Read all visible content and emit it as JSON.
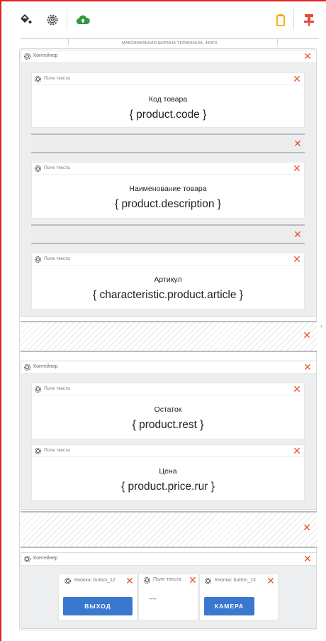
{
  "toolbar": {
    "icons": [
      "paint-bucket-icon",
      "settings-icon",
      "cloud-upload-icon",
      "clipboard-icon",
      "pin-icon"
    ],
    "colors": {
      "bucket": "#2b2b2b",
      "gear": "#444444",
      "cloud": "#2e9a3f",
      "clipboard": "#f2a900",
      "pin": "#e14d3a"
    }
  },
  "ruler_label": "МАКСИМАЛЬНАЯ ШИРИНА ТЕРМИНАЛА, 480PX",
  "containers": [
    {
      "label": "Контейнер",
      "fields": [
        {
          "label": "Поле текста",
          "title": "Код товара",
          "value": "{ product.code }"
        },
        {
          "label": "Поле текста",
          "title": "Наименование товара",
          "value": "{ product.description }"
        },
        {
          "label": "Поле текста",
          "title": "Артикул",
          "value": "{ characteristic.product.article }"
        }
      ]
    },
    {
      "label": "Контейнер",
      "fields": [
        {
          "label": "Поле текста",
          "title": "Остаток",
          "value": "{ product.rest }"
        },
        {
          "label": "Поле текста",
          "title": "Цена",
          "value": "{ product.price.rur }"
        }
      ]
    },
    {
      "label": "Контейнер",
      "cells": [
        {
          "label": "Кнопка: button_12",
          "button": "ВЫХОД"
        },
        {
          "label": "Поле текста",
          "text": "----"
        },
        {
          "label": "Кнопка: button_13",
          "button": "КАМЕРА"
        }
      ]
    }
  ],
  "close_symbol": "✕",
  "side_arrow": "‹",
  "accent": "#3a78cf",
  "close_color": "#e8552e",
  "frame_color": "#e41f1f"
}
